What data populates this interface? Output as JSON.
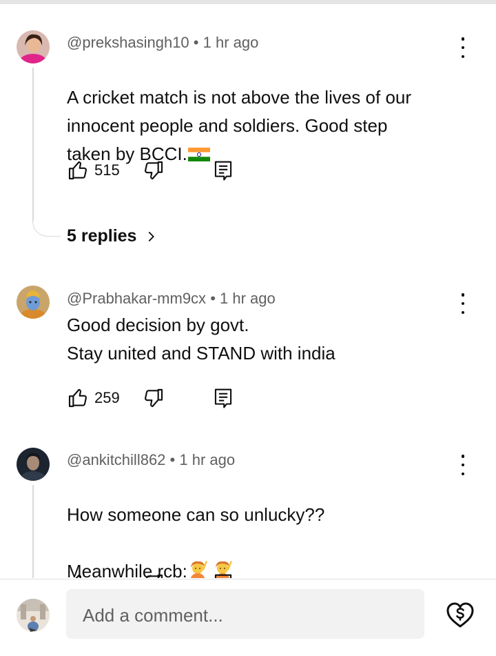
{
  "comments": [
    {
      "handle": "@prekshasingh10",
      "time": "1 hr ago",
      "text": "A cricket match is not above the lives of our\ninnocent people and soldiers. Good step\ntaken by BCCI.",
      "trailing_emoji": "india-flag",
      "likes": "515",
      "replies_label": "5 replies"
    },
    {
      "handle": "@Prabhakar-mm9cx",
      "time": "1 hr ago",
      "text": "Good decision by govt.\nStay united and STAND with india",
      "likes": "259"
    },
    {
      "handle": "@ankitchill862",
      "time": "1 hr ago",
      "text": "How someone can so unlucky??\n\nMeanwhile rcb:",
      "trailing_emoji": "person-raising-hand x2"
    }
  ],
  "separator": "•",
  "composer": {
    "placeholder": "Add a comment...",
    "thanks_icon": "heart-dollar-icon"
  },
  "icons": {
    "like": "thumb-up-icon",
    "dislike": "thumb-down-icon",
    "reply": "comment-icon",
    "more": "more-vert-icon",
    "chevron": "chevron-right-icon"
  }
}
